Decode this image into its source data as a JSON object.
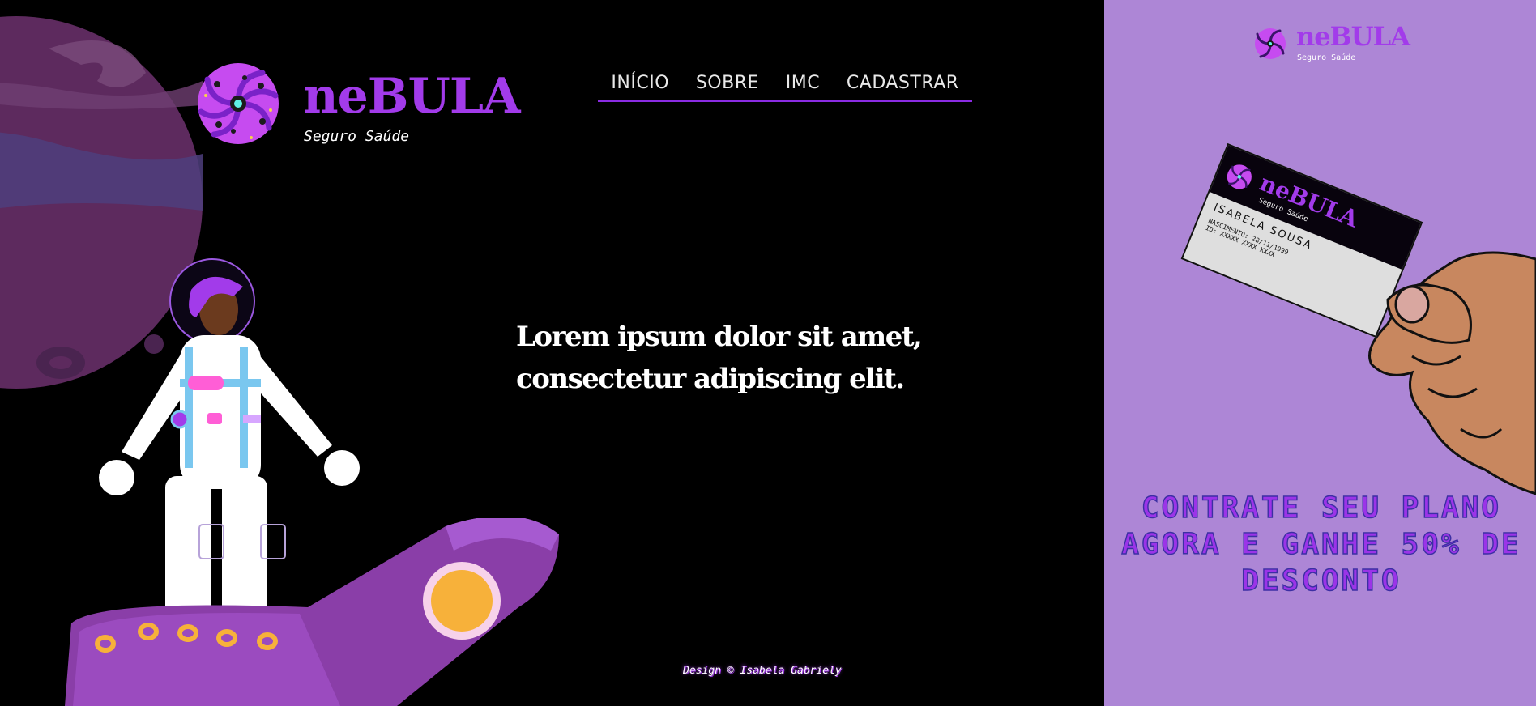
{
  "brand": {
    "name": "neBULA",
    "tagline": "Seguro Saúde"
  },
  "nav": {
    "items": [
      {
        "label": "INÍCIO"
      },
      {
        "label": "SOBRE"
      },
      {
        "label": "IMC"
      },
      {
        "label": "CADASTRAR"
      }
    ]
  },
  "hero": {
    "headline": "Lorem ipsum dolor sit amet, consectetur adipiscing elit."
  },
  "footer": {
    "credit": "Design © Isabela Gabriely"
  },
  "sidebar": {
    "brand_name": "neBULA",
    "brand_tagline": "Seguro Saúde",
    "card": {
      "brand_name": "neBULA",
      "brand_tagline": "Seguro Saúde",
      "holder_name": "ISABELA SOUSA",
      "birth": "NASCIMENTO: 28/11/1999",
      "id": "ID: XXXXX XXXX XXXX"
    },
    "promo_text": "CONTRATE SEU PLANO AGORA E GANHE 50% DE DESCONTO"
  },
  "colors": {
    "brand_purple": "#a23bea",
    "sidebar_bg": "#ad86d6",
    "background": "#000000",
    "promo_stroke": "#3c2fa3"
  }
}
